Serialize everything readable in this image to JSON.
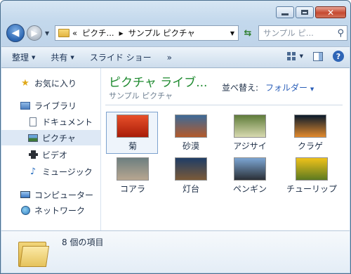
{
  "window": {
    "close_glyph": "✕"
  },
  "address": {
    "back_glyph": "◀",
    "forward_glyph": "▶",
    "overflow": "«",
    "crumbs": [
      "ピクチ...",
      "サンプル ピクチャ"
    ],
    "search_placeholder": "サンプル ピ..."
  },
  "toolbar": {
    "organize": "整理",
    "share": "共有",
    "slideshow": "スライド ショー",
    "more": "»",
    "help": "?"
  },
  "sidebar": {
    "favorites": "お気に入り",
    "libraries": "ライブラリ",
    "documents": "ドキュメント",
    "pictures": "ピクチャ",
    "video": "ビデオ",
    "music": "ミュージック",
    "computer": "コンピューター",
    "network": "ネットワーク"
  },
  "library": {
    "title": "ピクチャ ライブ...",
    "subtitle": "サンプル ピクチャ",
    "arrange_label": "並べ替え:",
    "arrange_value": "フォルダー"
  },
  "items": [
    {
      "label": "菊",
      "colors": [
        "#e8502a",
        "#a81c08"
      ]
    },
    {
      "label": "砂漠",
      "colors": [
        "#3c6a98",
        "#b45a2a"
      ]
    },
    {
      "label": "アジサイ",
      "colors": [
        "#5f7c3a",
        "#d8dab0"
      ]
    },
    {
      "label": "クラゲ",
      "colors": [
        "#0a1a2c",
        "#e38a2c"
      ]
    },
    {
      "label": "コアラ",
      "colors": [
        "#6d7f80",
        "#b8a690"
      ]
    },
    {
      "label": "灯台",
      "colors": [
        "#1f3d66",
        "#7c5a38"
      ]
    },
    {
      "label": "ペンギン",
      "colors": [
        "#7ca6d4",
        "#2a2f36"
      ]
    },
    {
      "label": "チューリップ",
      "colors": [
        "#f0c21a",
        "#5c7a20"
      ]
    }
  ],
  "details": {
    "count": "8 個の項目"
  }
}
